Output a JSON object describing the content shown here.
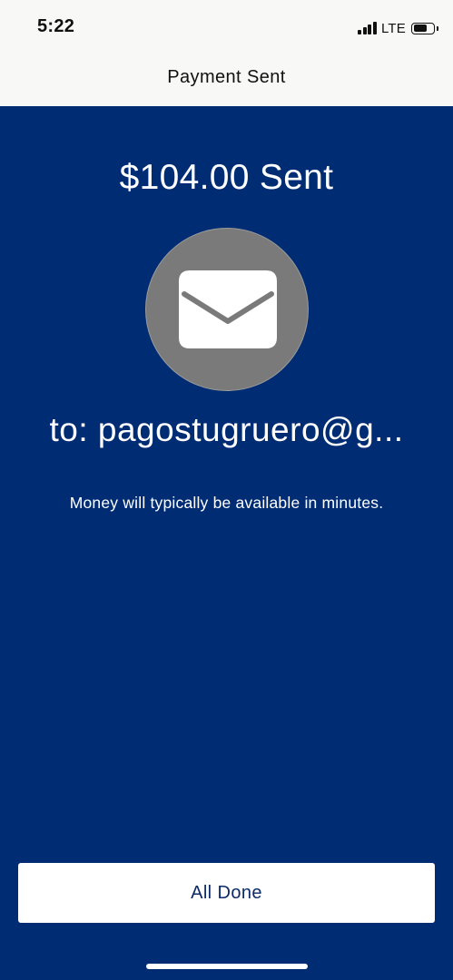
{
  "status_bar": {
    "time": "5:22",
    "network": "LTE",
    "signal_bars": 4,
    "battery_level_percent": 70
  },
  "header": {
    "title": "Payment Sent"
  },
  "main": {
    "amount_label": "$104.00 Sent",
    "icon": "envelope-icon",
    "recipient_label": "to: pagostugruero@g...",
    "note": "Money will typically be available in minutes."
  },
  "footer": {
    "done_label": "All Done"
  },
  "colors": {
    "background": "#002C73",
    "header_background": "#F8F8F6",
    "icon_circle": "#7A7A7A",
    "button_background": "#FFFFFF",
    "button_text": "#0B2A66"
  }
}
